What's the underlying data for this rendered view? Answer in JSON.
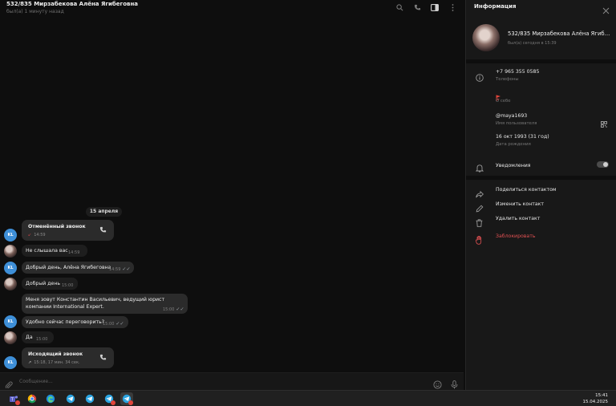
{
  "chat": {
    "title": "532/835 Мирзабекова Алёна Ягибеговна",
    "status": "был(а) 1 минуту назад",
    "date_separator": "15 апреля",
    "compose_placeholder": "Сообщение..."
  },
  "messages": [
    {
      "type": "call",
      "title": "Отменённый звонок",
      "time": "14:59",
      "avatar": "KL"
    },
    {
      "type": "text",
      "text": "Не слышала вас",
      "time": "14:59",
      "avatar": "photo"
    },
    {
      "type": "text",
      "text": "Добрый день, Алёна Ягибеговна",
      "time": "14:59",
      "avatar": "KL",
      "read": true
    },
    {
      "type": "text",
      "text": "Добрый день",
      "time": "15:00",
      "avatar": "photo"
    },
    {
      "type": "text",
      "text": "Меня зовут Константин Васильевич, ведущий юрист компании International Expert.",
      "time": "15:00",
      "read": true
    },
    {
      "type": "text",
      "text": "Удобно сейчас переговорить?",
      "time": "15:00",
      "avatar": "KL",
      "read": true
    },
    {
      "type": "text",
      "text": "Да",
      "time": "15:00",
      "avatar": "photo"
    },
    {
      "type": "call",
      "title": "Исходящий звонок",
      "time": "15:18, 17 мин. 34 сек.",
      "avatar": "KL"
    }
  ],
  "avatar_initials": "KL",
  "info": {
    "header": "Информация",
    "name": "532/835 Мирзабекова Алёна Ягибеговна",
    "seen": "был(а) сегодня в 15:39",
    "phone": "+7 965 355 0585",
    "phone_label": "Телефоны",
    "about_label": "О себе",
    "username": "@maya1693",
    "username_label": "Имя пользователя",
    "birthday": "16 окт 1993 (31 год)",
    "birthday_label": "Дата рождения",
    "notifications": "Уведомления",
    "notifications_on": true,
    "actions": {
      "share": "Поделиться контактом",
      "edit": "Изменить контакт",
      "delete": "Удалить контакт",
      "block": "Заблокировать"
    }
  },
  "taskbar": {
    "time": "15:41",
    "date": "15.04.2025",
    "apps": [
      "teams",
      "chrome",
      "edge",
      "telegram",
      "telegram",
      "telegram",
      "telegram",
      "telegram"
    ]
  },
  "colors": {
    "accent": "#3e8fd8",
    "danger": "#e05052",
    "bubble": "#2b2b2b",
    "background": "#0e0e0e"
  }
}
